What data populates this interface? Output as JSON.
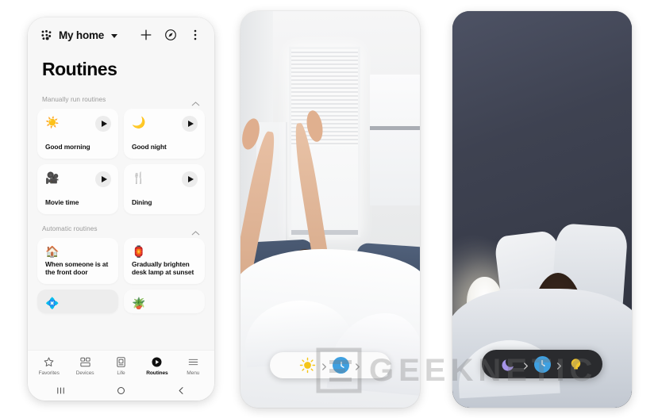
{
  "app": {
    "header": {
      "home_name": "My home",
      "home_icon": "grid-dots-icon",
      "add_icon": "plus-icon",
      "explore_icon": "compass-icon",
      "more_icon": "more-vertical-icon"
    },
    "page_title": "Routines",
    "sections": [
      {
        "title": "Manually run routines",
        "collapse_icon": "chevron-up-icon",
        "cards": [
          {
            "icon": "☀️",
            "label": "Good morning",
            "play": true
          },
          {
            "icon": "🌙",
            "label": "Good night",
            "play": true
          },
          {
            "icon": "🎥",
            "label": "Movie time",
            "play": true
          },
          {
            "icon": "🍴",
            "label": "Dining",
            "play": true
          }
        ]
      },
      {
        "title": "Automatic routines",
        "collapse_icon": "chevron-up-icon",
        "cards": [
          {
            "icon": "🏠",
            "label": "When someone is at the front door",
            "play": false
          },
          {
            "icon": "🏮",
            "label": "Gradually brighten desk lamp at sunset",
            "play": false
          }
        ],
        "peek_cards": [
          {
            "icon": "💠",
            "label": ""
          },
          {
            "icon": "🪴",
            "label": ""
          }
        ]
      }
    ],
    "bottom_nav": {
      "items": [
        {
          "label": "Favorites",
          "icon": "star-icon",
          "active": false
        },
        {
          "label": "Devices",
          "icon": "devices-grid-icon",
          "active": false
        },
        {
          "label": "Life",
          "icon": "life-card-icon",
          "active": false
        },
        {
          "label": "Routines",
          "icon": "routines-play-icon",
          "active": true
        },
        {
          "label": "Menu",
          "icon": "hamburger-menu-icon",
          "active": false
        }
      ]
    },
    "system_nav": {
      "recents_icon": "recents-icon",
      "home_icon": "home-circle-icon",
      "back_icon": "back-chevron-icon"
    }
  },
  "phone_middle": {
    "scene_alt": "Woman stretching awake in a bright white bedroom",
    "pill": {
      "theme": "light",
      "nodes": [
        {
          "type": "icon",
          "name": "sun-icon",
          "color": "#f5c518"
        },
        {
          "type": "chevron",
          "name": "chevron-right-icon"
        },
        {
          "type": "icon",
          "name": "clock-icon",
          "color": "#3fa0e0"
        },
        {
          "type": "chevron",
          "name": "chevron-right-icon"
        }
      ]
    }
  },
  "phone_right": {
    "scene_alt": "Woman sleeping in a dark bedroom with a lit lamp",
    "pill": {
      "theme": "dark",
      "nodes": [
        {
          "type": "icon",
          "name": "moon-icon",
          "color": "#a694e8"
        },
        {
          "type": "chevron",
          "name": "chevron-right-icon"
        },
        {
          "type": "icon",
          "name": "clock-icon",
          "color": "#3fa0e0"
        },
        {
          "type": "chevron",
          "name": "chevron-right-icon"
        },
        {
          "type": "icon",
          "name": "lamp-bulb-icon",
          "color": "#f2c72e"
        }
      ]
    }
  },
  "watermark": {
    "text": "GEEKNETIC",
    "logo": "geeknetic-logo-icon"
  },
  "colors": {
    "page_bg": "#ffffff",
    "app_bg": "#f7f7f7",
    "card_bg": "#fdfdfd",
    "text_primary": "#101010",
    "text_muted": "#9a9a9a",
    "pill_dark": "#2a2b2e",
    "accent_blue": "#3fa0e0",
    "accent_yellow": "#f5c518",
    "accent_purple": "#a694e8"
  }
}
